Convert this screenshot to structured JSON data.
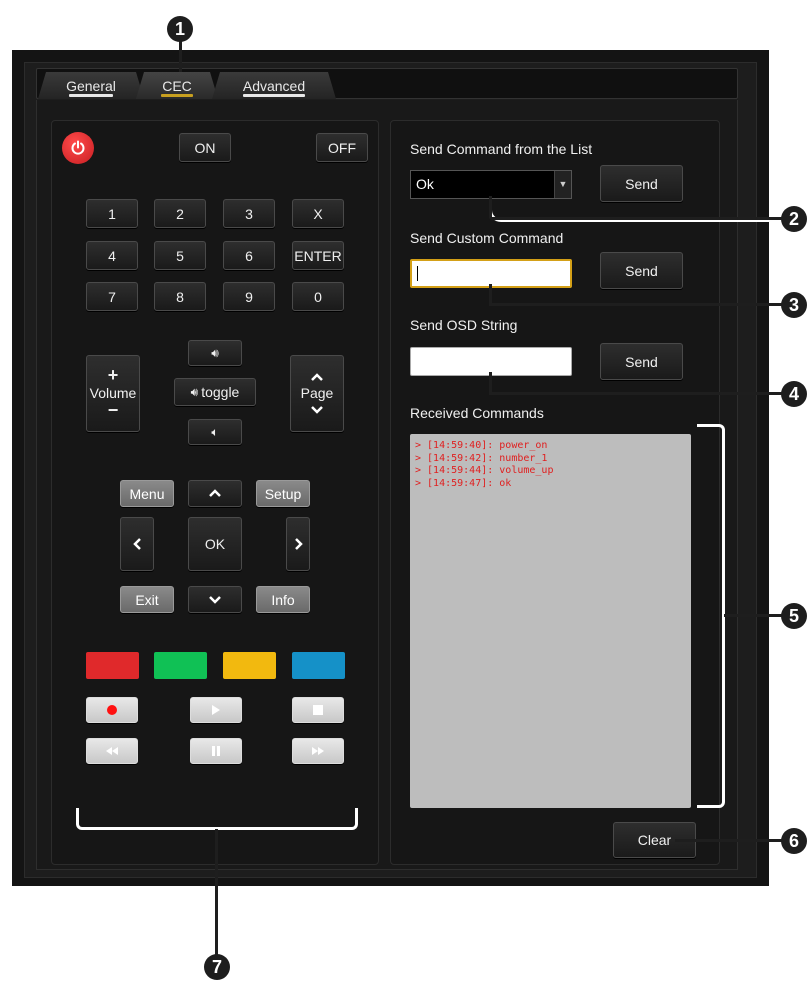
{
  "tabs": {
    "general": "General",
    "cec": "CEC",
    "advanced": "Advanced"
  },
  "remote": {
    "power_icon": "power-icon",
    "on": "ON",
    "off": "OFF",
    "keypad": [
      "1",
      "2",
      "3",
      "X",
      "4",
      "5",
      "6",
      "ENTER",
      "7",
      "8",
      "9",
      "0"
    ],
    "volume_plus": "+",
    "volume_label": "Volume",
    "volume_minus": "−",
    "mute_toggle": "toggle",
    "page_label": "Page",
    "menu": "Menu",
    "setup": "Setup",
    "ok": "OK",
    "exit": "Exit",
    "info": "Info",
    "colors": [
      "#e0292b",
      "#10c155",
      "#f2b90f",
      "#1591c8"
    ]
  },
  "right": {
    "send_list_label": "Send Command from the List",
    "send_list_value": "Ok",
    "send_label": "Send",
    "custom_label": "Send Custom Command",
    "osd_label": "Send OSD String",
    "received_label": "Received Commands",
    "log": [
      "> [14:59:40]: power_on",
      "> [14:59:42]: number_1",
      "> [14:59:44]: volume_up",
      "> [14:59:47]: ok"
    ],
    "clear": "Clear"
  },
  "callouts": [
    "1",
    "2",
    "3",
    "4",
    "5",
    "6",
    "7"
  ],
  "colors": {
    "accent_tab": "#c8a020",
    "power": "#d8252a",
    "log_text": "#e02020",
    "log_bg": "#bdbdbd"
  }
}
